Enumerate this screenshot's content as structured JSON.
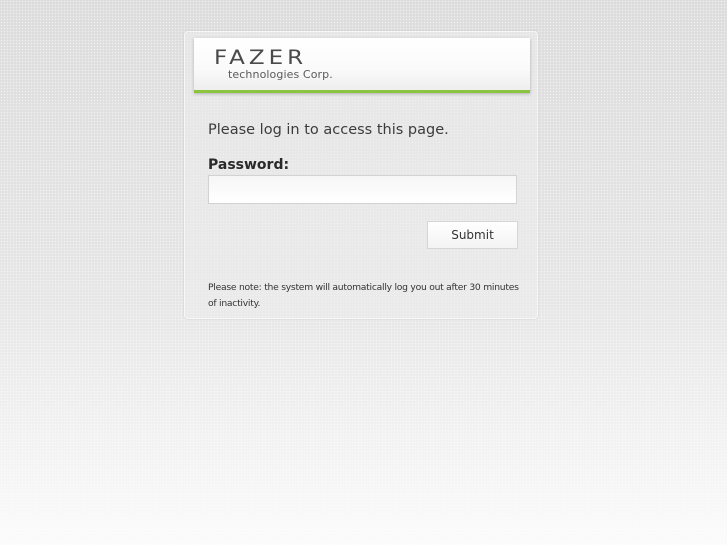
{
  "brand": {
    "name": "FAZER",
    "tagline": "technologies Corp.",
    "accent_color": "#8bc53f"
  },
  "login": {
    "intro": "Please log in to access this page.",
    "password_label": "Password:",
    "password_value": "",
    "submit_label": "Submit",
    "note": "Please note: the system will automatically log you out after 30 minutes of inactivity."
  }
}
